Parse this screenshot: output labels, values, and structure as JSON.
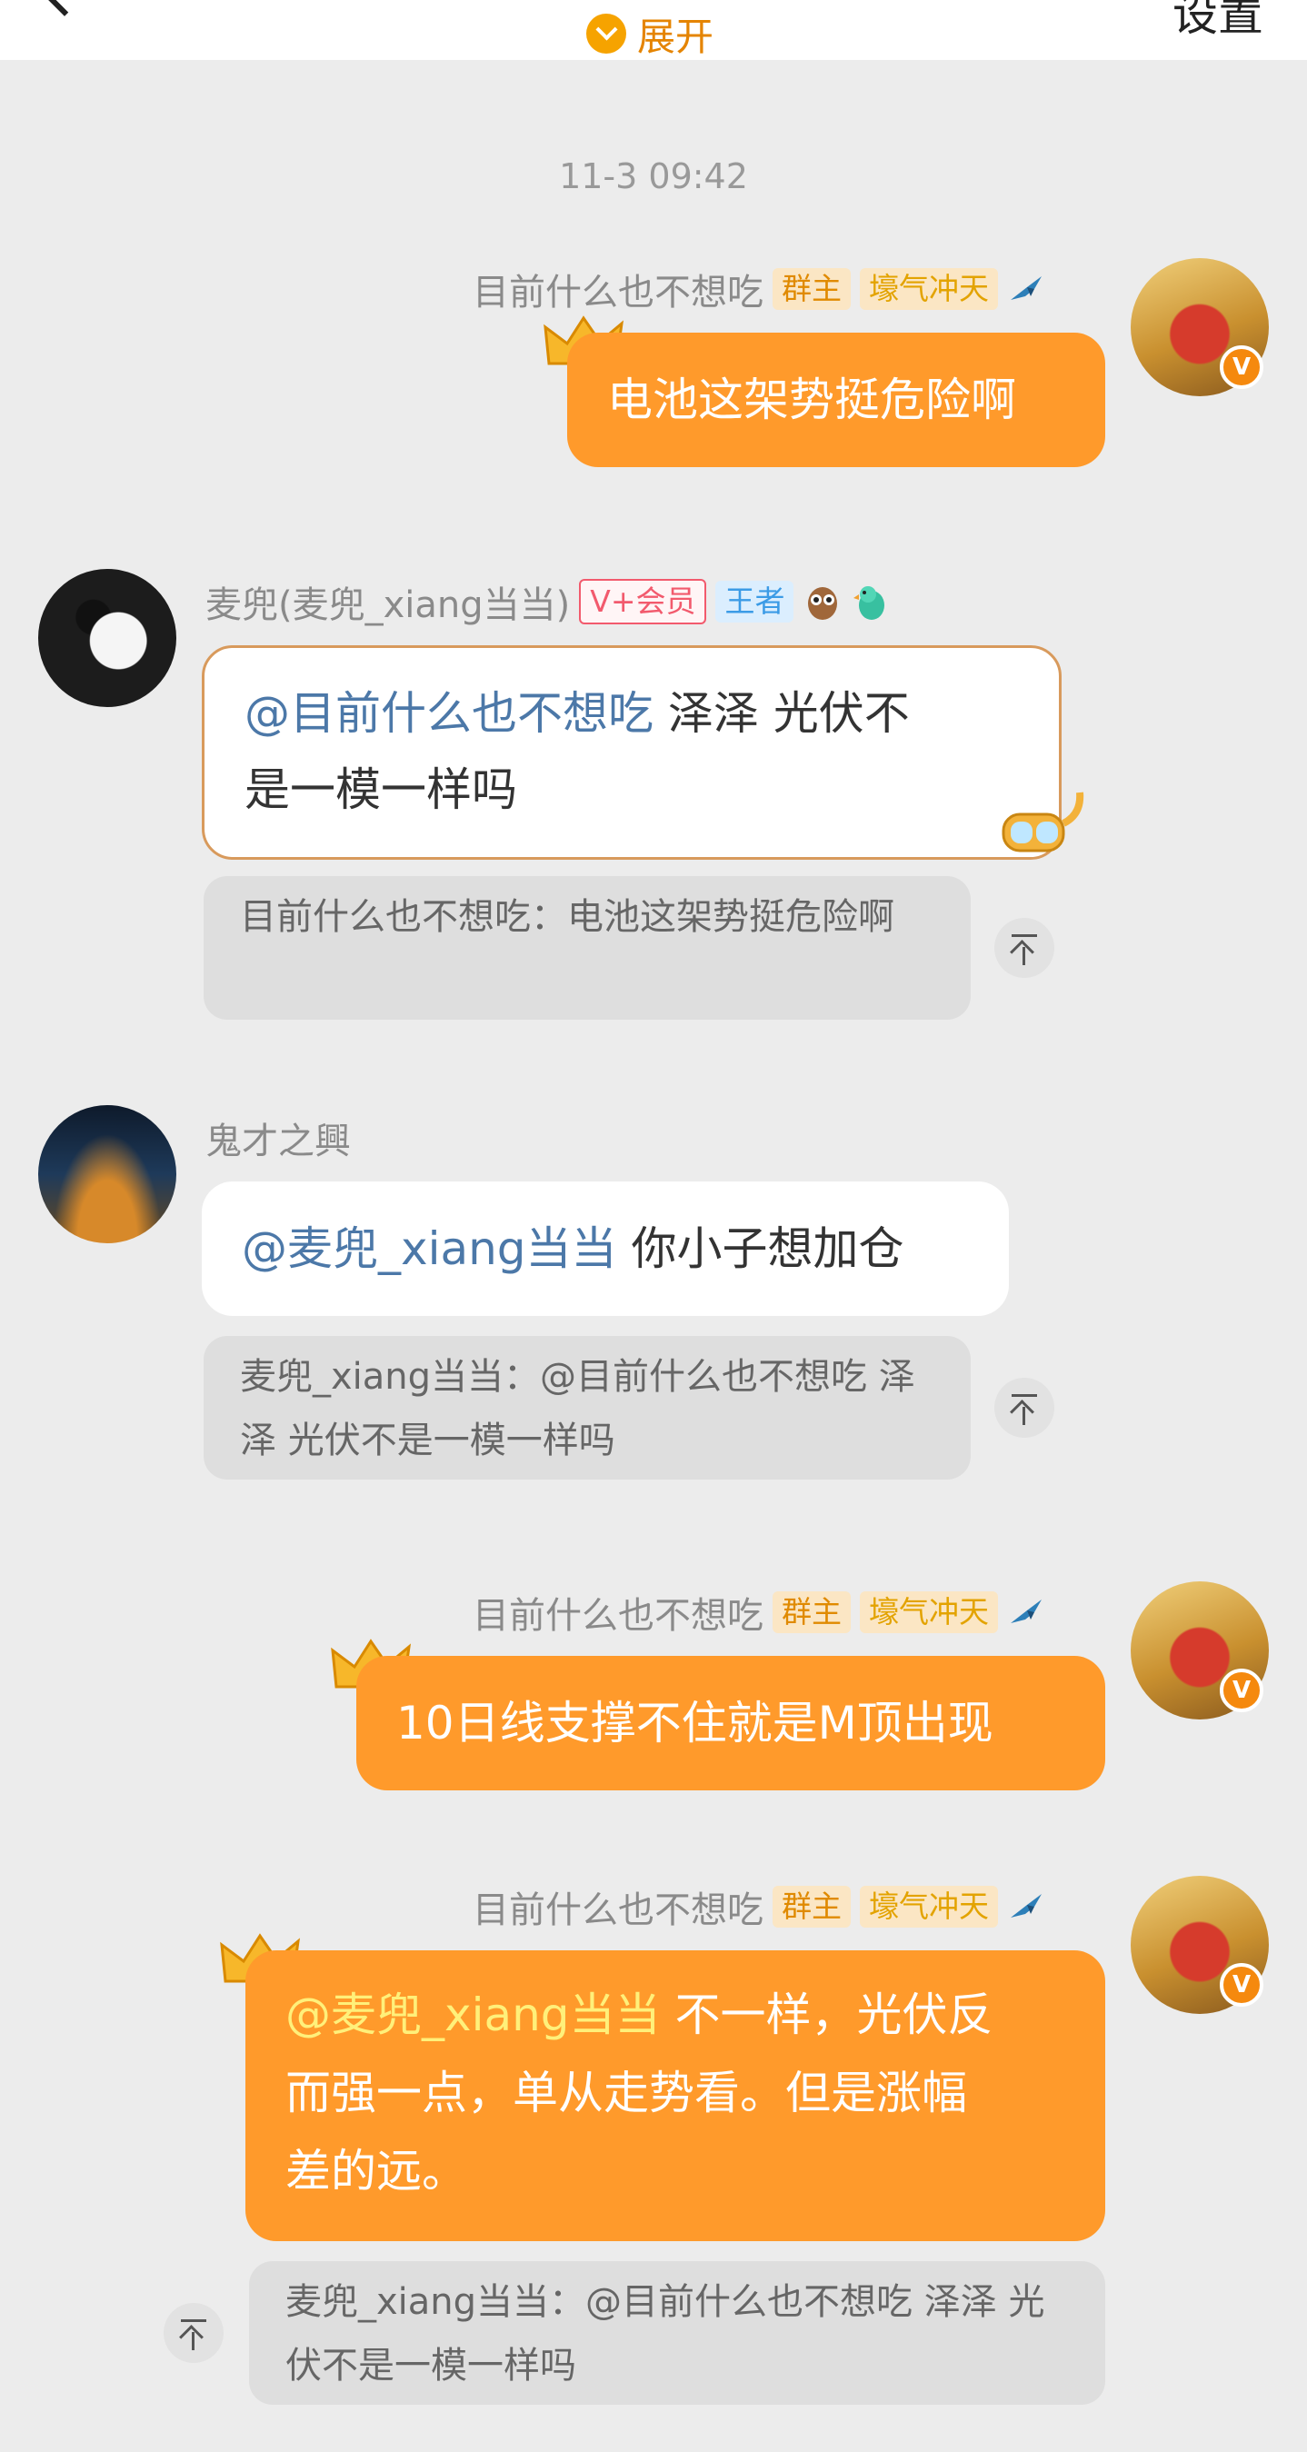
{
  "header": {
    "expand_label": "展开",
    "settings_label": "设置"
  },
  "timestamp": "11-3 09:42",
  "colors": {
    "accent": "#ff9a2b",
    "mention": "#4c78a8",
    "badge": "#f5890e"
  },
  "messages": [
    {
      "sender": "目前什么也不想吃",
      "tags": [
        "群主",
        "壕气冲天"
      ],
      "text": "电池这架势挺危险啊"
    },
    {
      "sender": "麦兜(麦兜_xiang当当)",
      "tags": [
        "V+会员",
        "王者"
      ],
      "mention": "@目前什么也不想吃",
      "text_line1": " 泽泽 光伏不",
      "text_line2": "是一模一样吗",
      "quote": "目前什么也不想吃：电池这架势挺危险啊"
    },
    {
      "sender": "鬼才之興",
      "mention": "@麦兜_xiang当当",
      "text": " 你小子想加仓",
      "quote": "麦兜_xiang当当：@目前什么也不想吃 泽泽 光伏不是一模一样吗"
    },
    {
      "sender": "目前什么也不想吃",
      "tags": [
        "群主",
        "壕气冲天"
      ],
      "text": "10日线支撑不住就是M顶出现"
    },
    {
      "sender": "目前什么也不想吃",
      "tags": [
        "群主",
        "壕气冲天"
      ],
      "mention": "@麦兜_xiang当当",
      "text_line1": " 不一样，光伏反",
      "text_line2": "而强一点，单从走势看。但是涨幅",
      "text_line3": "差的远。",
      "quote": "麦兜_xiang当当：@目前什么也不想吃 泽泽 光伏不是一模一样吗"
    }
  ]
}
